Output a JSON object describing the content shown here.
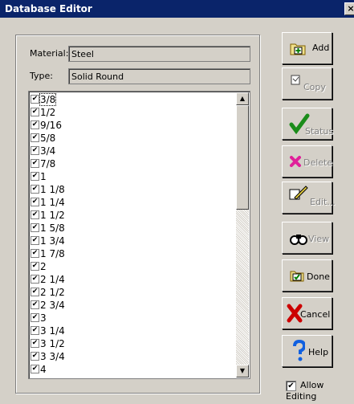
{
  "window": {
    "title": "Database Editor",
    "close_glyph": "×"
  },
  "material": {
    "label": "Material:",
    "value": "Steel"
  },
  "type": {
    "label": "Type:",
    "value": "Solid Round"
  },
  "list": {
    "items": [
      "3/8",
      "1/2",
      "9/16",
      "5/8",
      "3/4",
      "7/8",
      "1",
      "1 1/8",
      "1 1/4",
      "1 1/2",
      "1 5/8",
      "1 3/4",
      "1 7/8",
      "2",
      "2 1/4",
      "2 1/2",
      "2 3/4",
      "3",
      "3 1/4",
      "3 1/2",
      "3 3/4",
      "4"
    ],
    "checked": true,
    "selected_index": 0
  },
  "buttons": {
    "add": "Add",
    "copy": "Copy",
    "status": "Status",
    "delete": "Delete",
    "edit": "Edit...",
    "view": "View",
    "done": "Done",
    "cancel": "Cancel",
    "help": "Help"
  },
  "allow_editing": {
    "label": "Allow Editing",
    "checked": true
  },
  "icons": {
    "add": "add-folder-icon",
    "copy": "copy-icon",
    "status": "checkmark-icon",
    "delete": "delete-x-icon",
    "edit": "edit-pencil-icon",
    "view": "binoculars-icon",
    "done": "done-check-icon",
    "cancel": "cancel-x-icon",
    "help": "help-question-icon"
  },
  "colors": {
    "titlebar": "#0a246a",
    "face": "#d4d0c8"
  }
}
